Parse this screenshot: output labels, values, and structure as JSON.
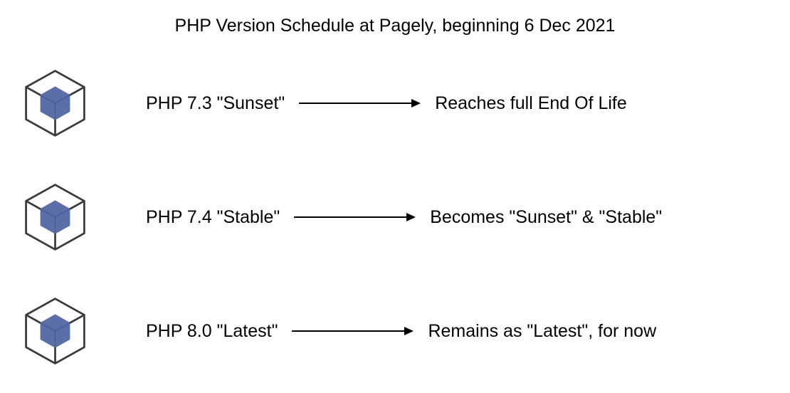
{
  "title": "PHP Version Schedule at Pagely, beginning 6 Dec 2021",
  "rows": [
    {
      "left": "PHP 7.3 \"Sunset\"",
      "right": "Reaches full End Of Life"
    },
    {
      "left": "PHP 7.4 \"Stable\"",
      "right": "Becomes \"Sunset\" & \"Stable\""
    },
    {
      "left": "PHP 8.0 \"Latest\"",
      "right": "Remains as \"Latest\", for now"
    }
  ],
  "colors": {
    "cube_inner": "#5A6FA8",
    "cube_outline": "#3A3A3A",
    "arrow": "#000000"
  }
}
